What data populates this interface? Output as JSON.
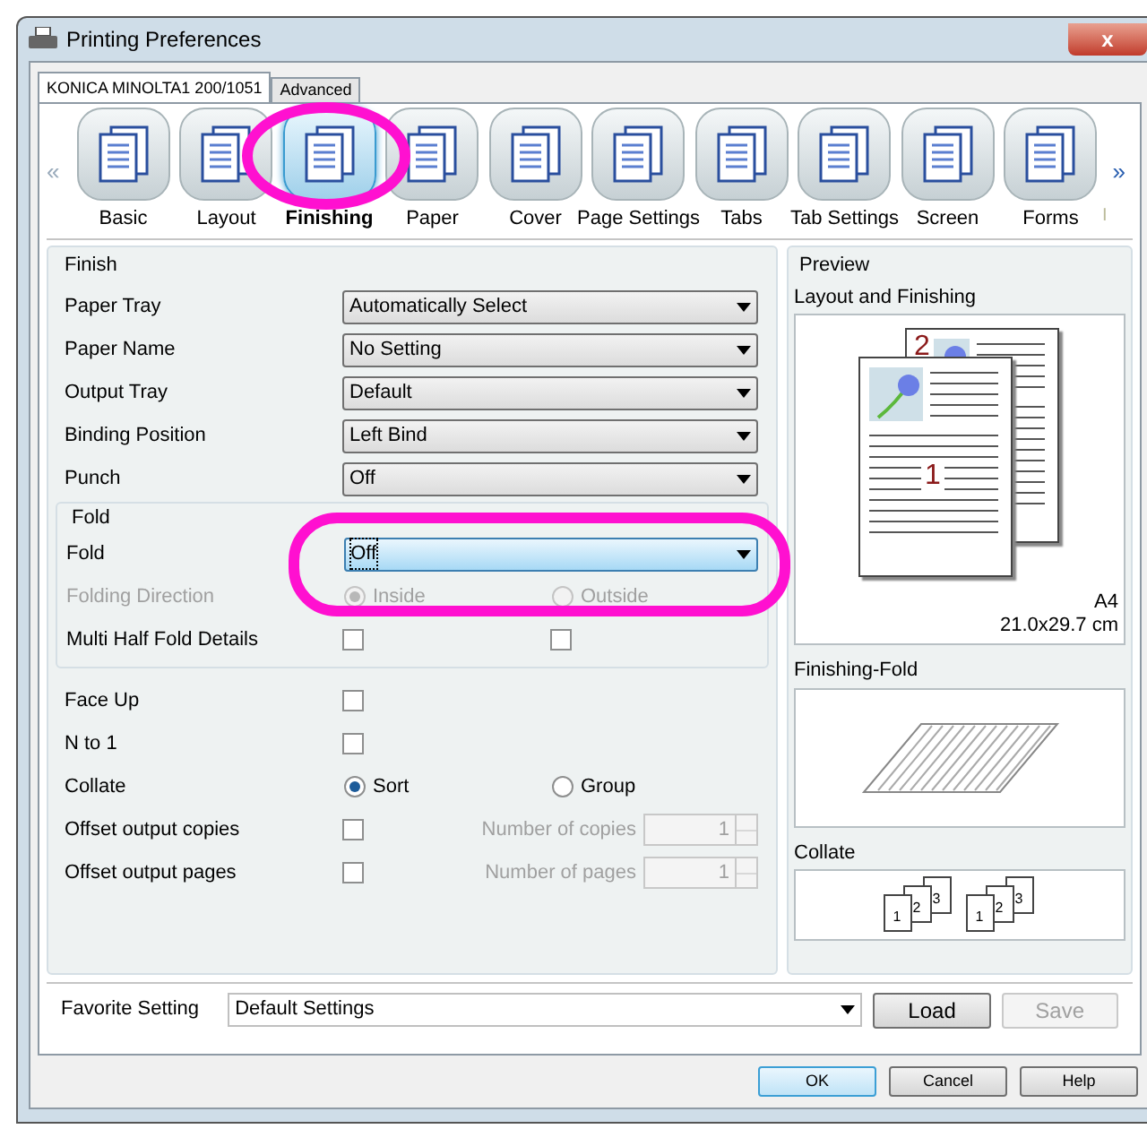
{
  "window": {
    "title": "Printing Preferences",
    "close": "x"
  },
  "tabs": [
    {
      "label": "KONICA MINOLTA1 200/1051",
      "selected": true
    },
    {
      "label": "Advanced",
      "selected": false
    }
  ],
  "toolbar": {
    "prev": "«",
    "next": "»",
    "more": "I",
    "items": [
      {
        "label": "Basic",
        "selected": false
      },
      {
        "label": "Layout",
        "selected": false
      },
      {
        "label": "Finishing",
        "selected": true
      },
      {
        "label": "Paper",
        "selected": false
      },
      {
        "label": "Cover",
        "selected": false
      },
      {
        "label": "Page Settings",
        "selected": false
      },
      {
        "label": "Tabs",
        "selected": false
      },
      {
        "label": "Tab Settings",
        "selected": false
      },
      {
        "label": "Screen",
        "selected": false
      },
      {
        "label": "Forms",
        "selected": false
      }
    ]
  },
  "finish": {
    "title": "Finish",
    "rows": [
      {
        "kind": "select",
        "label": "Paper Tray",
        "value": "Automatically Select",
        "focused": false
      },
      {
        "kind": "select",
        "label": "Paper Name",
        "value": "No Setting",
        "focused": false
      },
      {
        "kind": "select",
        "label": "Output Tray",
        "value": "Default",
        "focused": false
      },
      {
        "kind": "select",
        "label": "Binding Position",
        "value": "Left Bind",
        "focused": false
      },
      {
        "kind": "select",
        "label": "Punch",
        "value": "Off",
        "focused": false
      }
    ],
    "fold": {
      "title": "Fold",
      "rows": [
        {
          "kind": "select",
          "label": "Fold",
          "value": "Off",
          "focused": true
        },
        {
          "kind": "radio",
          "label": "Folding Direction",
          "disabled": true,
          "options": [
            {
              "label": "Inside",
              "selected": true
            },
            {
              "label": "Outside",
              "selected": false
            }
          ]
        },
        {
          "kind": "checks",
          "label": "Multi Half Fold Details",
          "boxes": [
            {
              "checked": false
            },
            {
              "checked": false
            }
          ]
        }
      ]
    },
    "rows2": [
      {
        "kind": "check",
        "label": "Face Up",
        "checked": false
      },
      {
        "kind": "check",
        "label": "N to 1",
        "checked": false
      },
      {
        "kind": "radio",
        "label": "Collate",
        "disabled": false,
        "options": [
          {
            "label": "Sort",
            "selected": true
          },
          {
            "label": "Group",
            "selected": false
          }
        ]
      },
      {
        "kind": "offset",
        "label": "Offset output copies",
        "checked": false,
        "spin_label": "Number of copies",
        "spin_value": "1"
      },
      {
        "kind": "offset",
        "label": "Offset output pages",
        "checked": false,
        "spin_label": "Number of pages",
        "spin_value": "1"
      }
    ]
  },
  "preview": {
    "title": "Preview",
    "layout_title": "Layout and Finishing",
    "page_numbers": [
      "2",
      "1"
    ],
    "paper_size": "A4",
    "paper_dims": "21.0x29.7 cm",
    "fold_title": "Finishing-Fold",
    "collate_title": "Collate",
    "collate_sets": [
      [
        "1",
        "2",
        "3"
      ],
      [
        "1",
        "2",
        "3"
      ]
    ]
  },
  "favorite": {
    "label": "Favorite Setting",
    "value": "Default Settings",
    "buttons": [
      {
        "label": "Load",
        "disabled": false
      },
      {
        "label": "Save",
        "disabled": true
      }
    ]
  },
  "buttons": [
    {
      "label": "OK",
      "default": true
    },
    {
      "label": "Cancel",
      "default": false
    },
    {
      "label": "Help",
      "default": false
    }
  ]
}
